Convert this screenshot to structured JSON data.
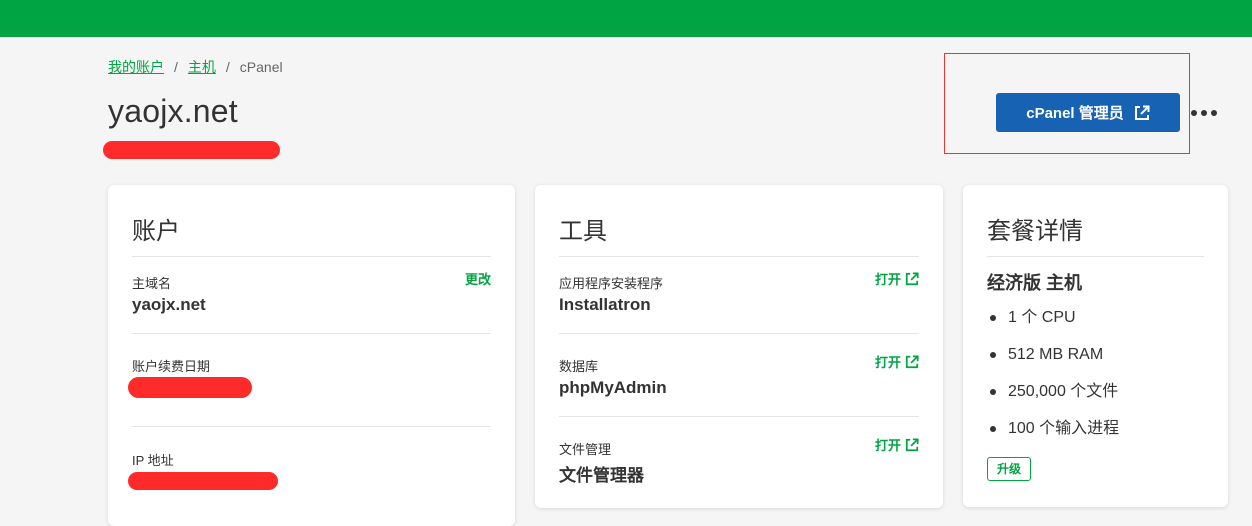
{
  "breadcrumb": {
    "items": [
      "我的账户",
      "主机",
      "cPanel"
    ],
    "separator": "/"
  },
  "page": {
    "title": "yaojx.net"
  },
  "header_actions": {
    "primary_label": "cPanel 管理员",
    "primary_icon": "external-link-icon",
    "more_icon": "more-dots-icon"
  },
  "account_card": {
    "title": "账户",
    "rows": [
      {
        "label": "主域名",
        "value": "yaojx.net",
        "action": "更改"
      },
      {
        "label": "账户续费日期",
        "value": ""
      },
      {
        "label": "IP 地址",
        "value": ""
      }
    ]
  },
  "tools_card": {
    "title": "工具",
    "rows": [
      {
        "label": "应用程序安装程序",
        "value": "Installatron",
        "action": "打开"
      },
      {
        "label": "数据库",
        "value": "phpMyAdmin",
        "action": "打开"
      },
      {
        "label": "文件管理",
        "value": "文件管理器",
        "action": "打开"
      }
    ]
  },
  "plan_card": {
    "title": "套餐详情",
    "plan_name": "经济版 主机",
    "features": [
      "1 个 CPU",
      "512 MB RAM",
      "250,000 个文件",
      "100 个输入进程"
    ],
    "upgrade_label": "升级"
  },
  "colors": {
    "brand_green": "#00a443",
    "primary_blue": "#1762b3",
    "redaction_red": "#ff2b2b",
    "highlight_box": "#e53935"
  }
}
